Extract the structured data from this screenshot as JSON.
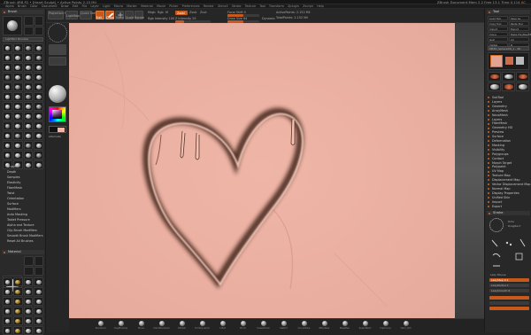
{
  "window": {
    "title": "ZBrush 4R8 P2 • [Heart Sculpt] • Active Points 2.15 Mil",
    "right_status": "ZBrush Document   Mem 2.2   Free 13.1   Time 0.114",
    "right_status_accent": "AC"
  },
  "menubar": [
    "Alpha",
    "Brush",
    "Color",
    "Document",
    "Draw",
    "Edit",
    "File",
    "Layer",
    "Light",
    "Macro",
    "Marker",
    "Material",
    "Movie",
    "Picker",
    "Preferences",
    "Render",
    "Stencil",
    "Stroke",
    "Texture",
    "Tool",
    "Transform",
    "Zplugin",
    "Zscript",
    "Help"
  ],
  "shelf": {
    "labels": {
      "projection_master": "Projection Master",
      "lightbox": "LightBox",
      "quick_sketch": "Quick Sketch",
      "edit": "Edit",
      "draw": "Draw",
      "move": "Move",
      "scale": "Scale",
      "rotate": "Rotate",
      "mrgb": "Mrgb",
      "rgb": "Rgb",
      "m": "M",
      "zadd": "Zadd",
      "zsub": "Zsub",
      "zcut": "Zcut",
      "focal_shift": "Focal Shift 0",
      "draw_size": "Draw Size 64",
      "dynamic": "Dynamic",
      "z_intensity": "Z Intensity 25",
      "rgb_intensity": "Rgb Intensity 100",
      "active_points": "ActivePoints: 2.152 Mil",
      "total_points": "TotalPoints: 2.152 Mil"
    },
    "z_intensity": 25,
    "draw_size_fraction": 0.5
  },
  "left": {
    "brush_header": "Brush",
    "brush_grid_labels": [
      "Load Brush",
      "Save As",
      "Clone",
      "LightBox Brushes"
    ],
    "menu_items": [
      "Brush",
      "Depth",
      "Samples",
      "Elasticity",
      "FiberMesh",
      "Twist",
      "Orientation",
      "Surface",
      "Modifiers",
      "Auto Masking",
      "Tablet Pressure",
      "Alpha and Texture",
      "Clip Brush Modifiers",
      "Smooth Brush Modifiers",
      "Reset All Brushes"
    ],
    "material_header": "Material",
    "material_grid_labels": [
      "Load",
      "Save",
      "Lightbox Materials"
    ]
  },
  "toolcol": {
    "labels": [
      "Gradient",
      "SwitchColor",
      "Alternate"
    ]
  },
  "bottombar": {
    "items": [
      "Standard",
      "ClayBuildup",
      "Move",
      "DamStandard",
      "hPolish",
      "TrimDynamic",
      "Inflat",
      "Pinch",
      "SnakeHook",
      "Slash3",
      "CurveTube",
      "ZModeler",
      "MaskPen",
      "SelectRect",
      "ClipCurve",
      "Dam_Std"
    ]
  },
  "right": {
    "tool_header": "Tool",
    "tool_buttons": [
      "Load Tool",
      "Save As",
      "Copy Tool",
      "Paste Tool",
      "Import",
      "Export",
      "Clone",
      "Make PolyMesh3D",
      "GoZ",
      "All",
      "Visible",
      "R"
    ],
    "lightbox_tools": "Lightbox▸Tools",
    "tool_name": "PM3D_Sphere3D_1 . 48",
    "menu_items": [
      "SubTool",
      "Layers",
      "Geometry",
      "ArrayMesh",
      "NanoMesh",
      "Layers",
      "FiberMesh",
      "Geometry HD",
      "Preview",
      "Surface",
      "Deformation",
      "Masking",
      "Visibility",
      "Polygroups",
      "Contact",
      "Morph Target",
      "Polypaint",
      "UV Map",
      "Texture Map",
      "Displacement Map",
      "Vector Displacement Map",
      "Normal Map",
      "Display Properties",
      "Unified Skin",
      "Import",
      "Export"
    ],
    "stroke_header": "Stroke",
    "stroke_labels": [
      "Dots",
      "DragRect",
      "FreeHand",
      "Spray",
      "DragDot",
      "Lazy Mouse",
      "LazyStep 0.1",
      "LazyRadius 1",
      "LazySmooth 8"
    ]
  },
  "colors": {
    "accent": "#c8591a",
    "canvas_pink": "#ebb0a2",
    "heart_shadow": "#4a2a1c",
    "ui_dark": "#232323"
  }
}
